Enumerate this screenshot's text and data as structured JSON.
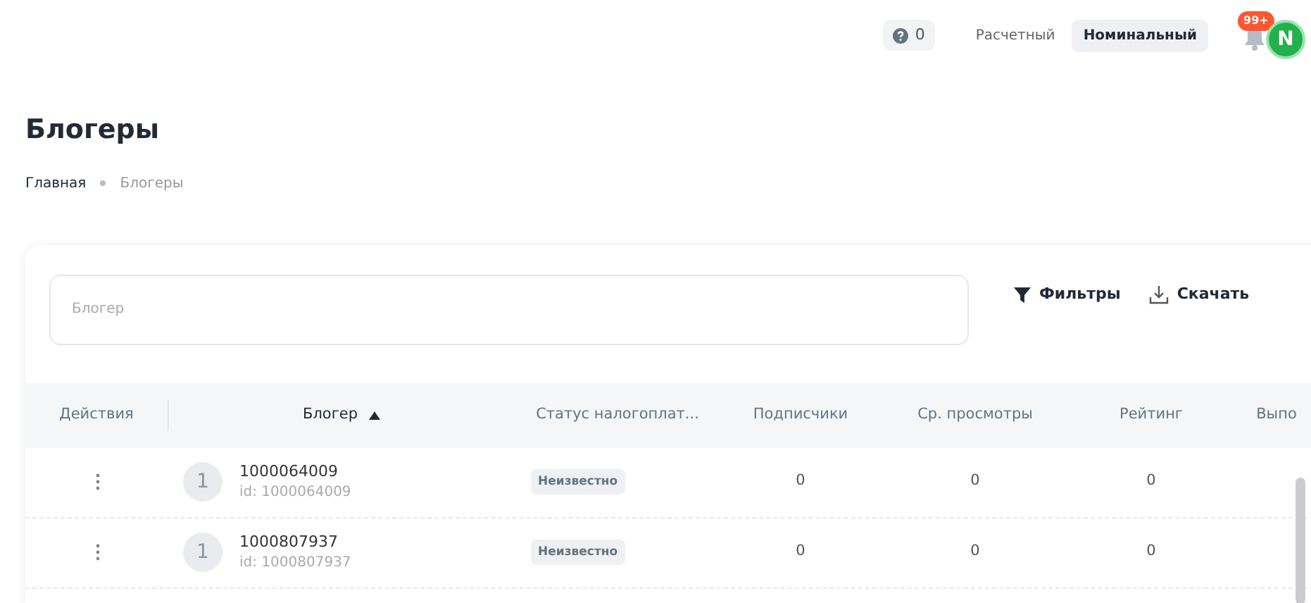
{
  "header": {
    "help_count": "0",
    "modes": [
      {
        "label": "Расчетный",
        "selected": false
      },
      {
        "label": "Номинальный",
        "selected": true
      }
    ],
    "notifications_badge": "99+",
    "avatar_letter": "N"
  },
  "page_title": "Блогеры",
  "breadcrumb": [
    {
      "label": "Главная",
      "current": false
    },
    {
      "label": "Блогеры",
      "current": true
    }
  ],
  "search": {
    "placeholder": "Блогер"
  },
  "toolbar": [
    "Фильтры",
    "Скачать"
  ],
  "table": {
    "columns": [
      {
        "label": "Действия",
        "sorted": false
      },
      {
        "label": "Блогер",
        "sorted": true
      },
      {
        "label": "Статус налогоплат...",
        "sorted": false
      },
      {
        "label": "Подписчики",
        "sorted": false
      },
      {
        "label": "Ср. просмотры",
        "sorted": false
      },
      {
        "label": "Рейтинг",
        "sorted": false
      },
      {
        "label": "Выпо",
        "sorted": false
      }
    ],
    "rows": [
      {
        "avatar": "1",
        "name": "1000064009",
        "id": "id: 1000064009",
        "status": "Неизвестно",
        "subscribers": "0",
        "views": "0",
        "rating": "0"
      },
      {
        "avatar": "1",
        "name": "1000807937",
        "id": "id: 1000807937",
        "status": "Неизвестно",
        "subscribers": "0",
        "views": "0",
        "rating": "0"
      }
    ]
  }
}
